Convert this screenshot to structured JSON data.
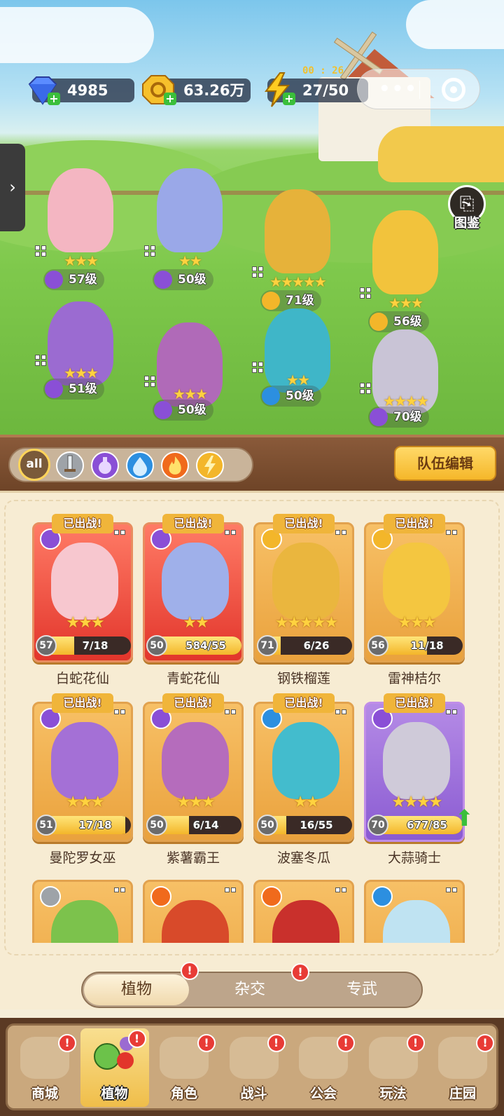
{
  "resources": {
    "gems": "4985",
    "coins": "63.26万",
    "energy": "27/50",
    "energy_timer": "00 : 26"
  },
  "capsule": {
    "more_icon": "more-dots-icon",
    "close_icon": "target-icon"
  },
  "codex_label": "图鉴",
  "field_units": [
    {
      "stars": 3,
      "level": "57级",
      "element": "poison",
      "color": "#f4b6c2"
    },
    {
      "stars": 2,
      "level": "50级",
      "element": "poison",
      "color": "#9aa8e8"
    },
    {
      "stars": 5,
      "level": "71级",
      "element": "thunder",
      "color": "#e6b23a"
    },
    {
      "stars": 3,
      "level": "56级",
      "element": "thunder",
      "color": "#f2c33c"
    },
    {
      "stars": 3,
      "level": "51级",
      "element": "poison",
      "color": "#9b6bd1"
    },
    {
      "stars": 3,
      "level": "50级",
      "element": "poison",
      "color": "#b06ab8"
    },
    {
      "stars": 2,
      "level": "50级",
      "element": "water",
      "color": "#3fb6c8"
    },
    {
      "stars": 4,
      "level": "70级",
      "element": "poison",
      "color": "#c9c4d6"
    }
  ],
  "filters": {
    "all_label": "all",
    "items": [
      "sword",
      "poison",
      "water",
      "fire",
      "thunder"
    ]
  },
  "team_edit_label": "队伍编辑",
  "colors": {
    "sword": "#9ea3a8",
    "poison": "#8a4fd6",
    "water": "#2c8fe0",
    "fire": "#f06a1c",
    "thunder": "#f3b62a"
  },
  "deployed_label": "已出战!",
  "cards": [
    {
      "name": "白蛇花仙",
      "level": "57",
      "progress": "7/18",
      "stars": 3,
      "element": "poison",
      "frame": "red",
      "deployed": true,
      "fill": 0.39,
      "color": "#f7c7cf"
    },
    {
      "name": "青蛇花仙",
      "level": "50",
      "progress": "584/55",
      "stars": 2,
      "element": "poison",
      "frame": "red",
      "deployed": true,
      "fill": 1,
      "color": "#9fb0ea"
    },
    {
      "name": "钢铁榴莲",
      "level": "71",
      "progress": "6/26",
      "stars": 5,
      "element": "thunder",
      "frame": "gold",
      "deployed": true,
      "fill": 0.23,
      "color": "#eab63e"
    },
    {
      "name": "雷神桔尔",
      "level": "56",
      "progress": "11/18",
      "stars": 3,
      "element": "thunder",
      "frame": "gold",
      "deployed": true,
      "fill": 0.61,
      "color": "#f4c640"
    },
    {
      "name": "曼陀罗女巫",
      "level": "51",
      "progress": "17/18",
      "stars": 3,
      "element": "poison",
      "frame": "gold",
      "deployed": true,
      "fill": 0.94,
      "color": "#a470d6"
    },
    {
      "name": "紫薯霸王",
      "level": "50",
      "progress": "6/14",
      "stars": 3,
      "element": "poison",
      "frame": "gold",
      "deployed": true,
      "fill": 0.43,
      "color": "#b56cbc"
    },
    {
      "name": "波塞冬瓜",
      "level": "50",
      "progress": "16/55",
      "stars": 2,
      "element": "water",
      "frame": "gold",
      "deployed": true,
      "fill": 0.29,
      "color": "#43bccd"
    },
    {
      "name": "大蒜骑士",
      "level": "70",
      "progress": "677/85",
      "stars": 4,
      "element": "poison",
      "frame": "purple",
      "deployed": true,
      "fill": 1,
      "color": "#cfcad9"
    },
    {
      "element": "sword",
      "frame": "gold",
      "color": "#7cc24c"
    },
    {
      "element": "fire",
      "frame": "gold",
      "color": "#d84a2a"
    },
    {
      "element": "fire",
      "frame": "gold",
      "color": "#c9302c"
    },
    {
      "element": "water",
      "frame": "gold",
      "color": "#bfe3f2"
    }
  ],
  "subtabs": [
    "植物",
    "杂交",
    "专武"
  ],
  "nav": [
    "商城",
    "植物",
    "角色",
    "战斗",
    "公会",
    "玩法",
    "庄园"
  ],
  "alert_glyph": "!"
}
